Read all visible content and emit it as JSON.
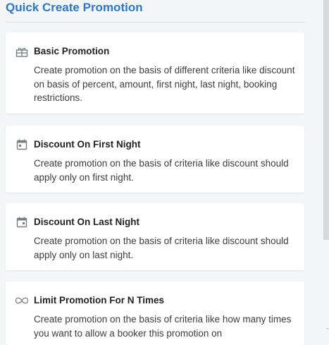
{
  "panel": {
    "title": "Quick Create Promotion"
  },
  "cards": [
    {
      "icon": "gift-icon",
      "title": "Basic Promotion",
      "description": "Create promotion on the basis of different criteria like discount on basis of percent, amount, first night, last night, booking restrictions."
    },
    {
      "icon": "calendar-icon",
      "title": "Discount On First Night",
      "description": "Create promotion on the basis of criteria like discount should apply only on first night."
    },
    {
      "icon": "calendar-icon",
      "title": "Discount On Last Night",
      "description": "Create promotion on the basis of criteria like discount should apply only on last night."
    },
    {
      "icon": "infinity-icon",
      "title": "Limit Promotion For N Times",
      "description": "Create promotion on the basis of criteria like how many times you want to allow a booker this promotion on"
    }
  ],
  "colors": {
    "title": "#2a78c9",
    "background": "#f4f5f7",
    "card": "#ffffff",
    "icon": "#7a7f85"
  }
}
